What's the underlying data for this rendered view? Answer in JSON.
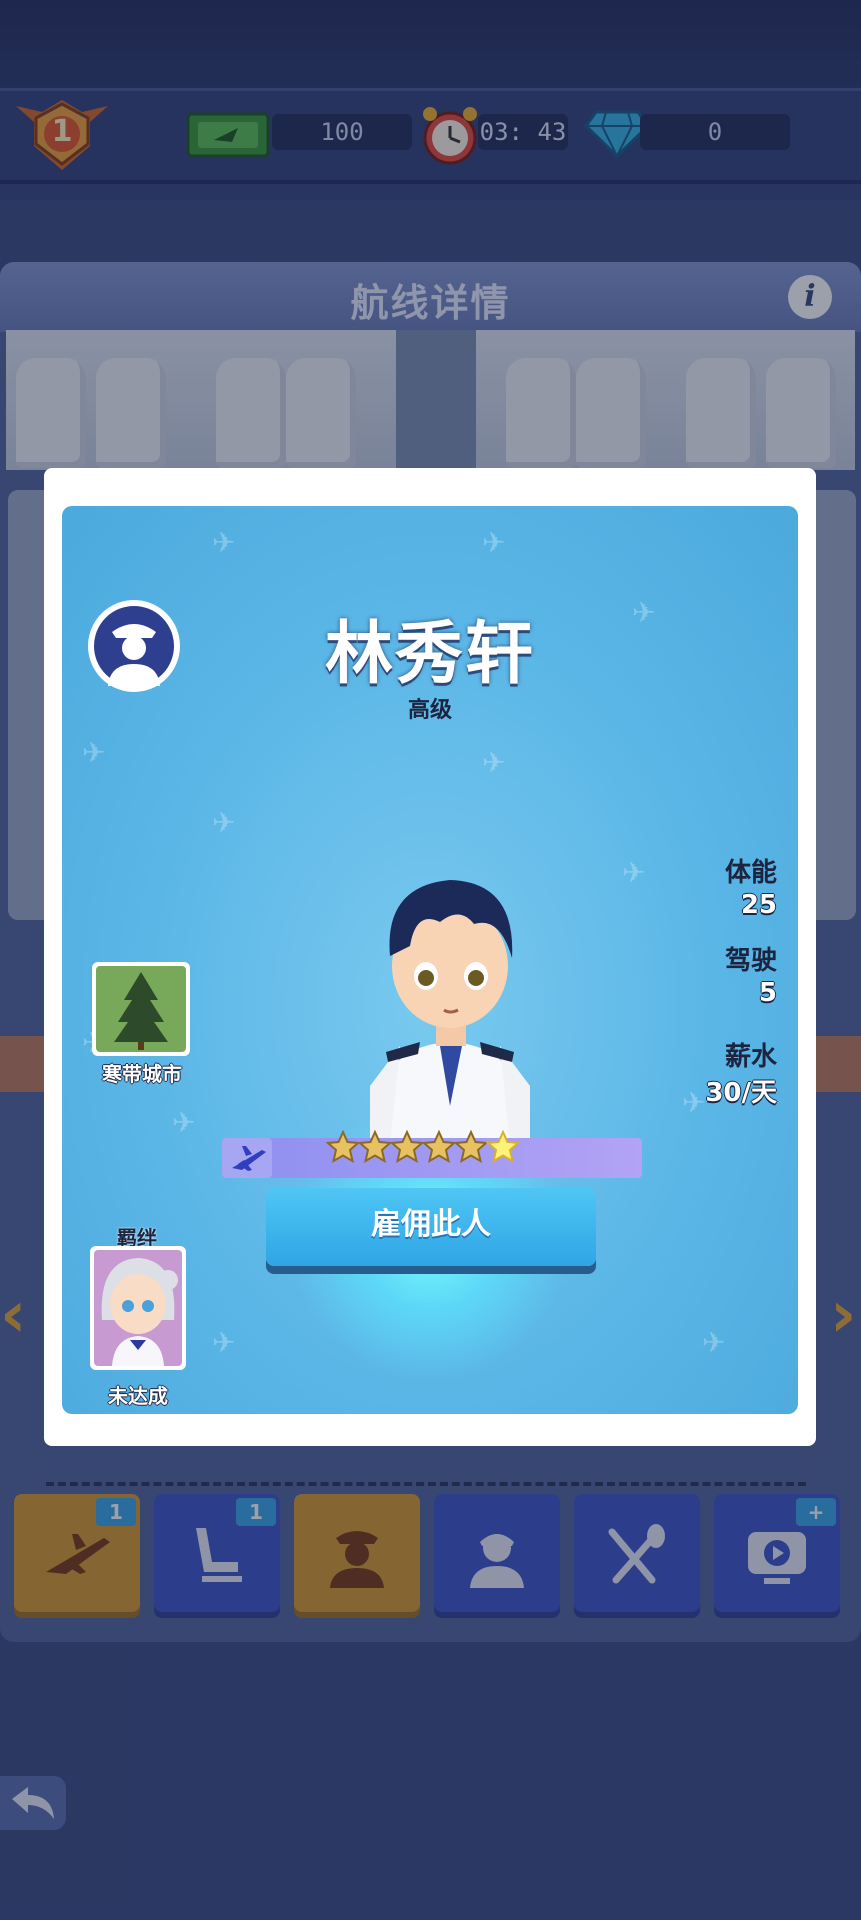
{
  "hud": {
    "rank_level": "1",
    "cash": "100",
    "timer": "03: 43",
    "gems": "0"
  },
  "panel": {
    "title": "航线详情",
    "info_label": "i"
  },
  "tabs": [
    {
      "icon": "airplane-icon",
      "badge": "1",
      "active": true
    },
    {
      "icon": "seat-icon",
      "badge": "1",
      "active": false
    },
    {
      "icon": "pilot-icon",
      "badge": "",
      "active": true
    },
    {
      "icon": "flight-attendant-icon",
      "badge": "",
      "active": false
    },
    {
      "icon": "fork-spoon-icon",
      "badge": "",
      "active": false
    },
    {
      "icon": "tv-icon",
      "badge": "+",
      "active": false
    }
  ],
  "modal": {
    "name": "林秀轩",
    "rank": "高级",
    "stats": {
      "stamina_label": "体能",
      "stamina_value": "25",
      "driving_label": "驾驶",
      "driving_value": "5",
      "salary_label": "薪水",
      "salary_value": "30/天"
    },
    "city": "寒带城市",
    "bond_title": "羁绊",
    "bond_status": "未达成",
    "stars": {
      "filled": 6,
      "total": 6
    },
    "hire_label": "雇佣此人"
  },
  "colors": {
    "accent_blue": "#3f56c8",
    "accent_gold": "#d89a2e",
    "card_bg": "#5ab6e6"
  }
}
